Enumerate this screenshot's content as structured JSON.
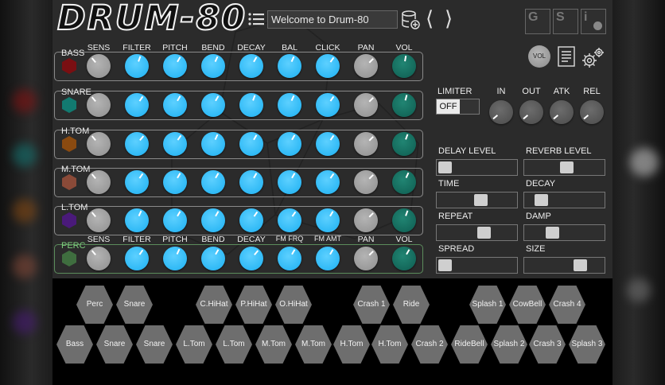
{
  "header": {
    "logo": "DRUM-80",
    "preset_text": "Welcome to Drum-80",
    "nav_prev": "⟨",
    "nav_next": "⟩",
    "buttons": [
      "G",
      "S",
      "i"
    ]
  },
  "columns_top": [
    "SENS",
    "FILTER",
    "PITCH",
    "BEND",
    "DECAY",
    "BAL",
    "CLICK",
    "PAN",
    "VOL"
  ],
  "columns_perc": [
    "SENS",
    "FILTER",
    "PITCH",
    "BEND",
    "DECAY",
    "FM FRQ",
    "FM AMT",
    "PAN",
    "VOL"
  ],
  "rows": [
    {
      "label": "BASS",
      "color": "#7a0f12",
      "angles": [
        -40,
        20,
        30,
        25,
        30,
        25,
        35,
        45,
        10
      ]
    },
    {
      "label": "SNARE",
      "color": "#127a70",
      "angles": [
        -40,
        35,
        30,
        30,
        20,
        25,
        35,
        45,
        15
      ]
    },
    {
      "label": "H.TOM",
      "color": "#8a4a10",
      "angles": [
        -40,
        40,
        35,
        25,
        30,
        30,
        35,
        45,
        20
      ]
    },
    {
      "label": "M.TOM",
      "color": "#8a4a38",
      "angles": [
        -40,
        35,
        30,
        30,
        30,
        30,
        35,
        45,
        25
      ]
    },
    {
      "label": "L.TOM",
      "color": "#4a1a7a",
      "angles": [
        -40,
        25,
        30,
        30,
        35,
        35,
        30,
        45,
        20
      ]
    },
    {
      "label": "PERC",
      "color": "#3f6e3f",
      "angles": [
        -40,
        35,
        25,
        30,
        40,
        30,
        30,
        45,
        30
      ]
    }
  ],
  "master": {
    "vol_label": "VOL"
  },
  "fx": {
    "limiter_label": "LIMITER",
    "limiter_state": "OFF",
    "dyn_labels": [
      "IN",
      "OUT",
      "ATK",
      "REL"
    ],
    "sliders": [
      {
        "label": "DELAY LEVEL",
        "value": 0.0
      },
      {
        "label": "REVERB LEVEL",
        "value": 0.53
      },
      {
        "label": "TIME",
        "value": 0.55
      },
      {
        "label": "DECAY",
        "value": 0.13
      },
      {
        "label": "REPEAT",
        "value": 0.6
      },
      {
        "label": "DAMP",
        "value": 0.3
      },
      {
        "label": "SPREAD",
        "value": 0.0
      },
      {
        "label": "SIZE",
        "value": 0.73
      }
    ]
  },
  "pads_top": [
    "Perc",
    "Snare",
    "C.HiHat",
    "P.HiHat",
    "O.HiHat",
    "Crash 1",
    "Ride",
    "Splash 1",
    "CowBell",
    "Crash 4"
  ],
  "pads_bottom": [
    "Bass",
    "Snare",
    "Snare",
    "L.Tom",
    "L.Tom",
    "M.Tom",
    "M.Tom",
    "H.Tom",
    "H.Tom",
    "Crash 2",
    "RideBell",
    "Splash 2",
    "Crash 3",
    "Splash 3"
  ],
  "colors": {
    "knob_blue": "#1cb0f2",
    "knob_gray": "#9a9a9a",
    "knob_teal": "#0e5c50",
    "pad": "#6e6e6e"
  }
}
